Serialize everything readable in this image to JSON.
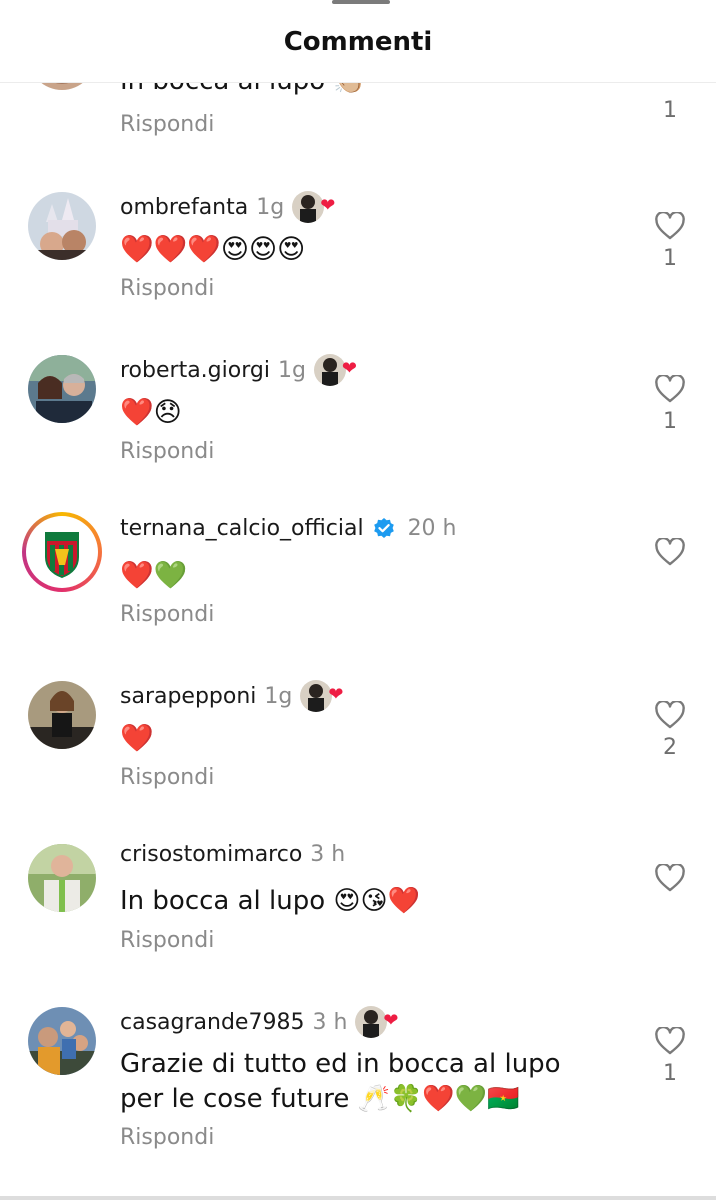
{
  "header": {
    "title": "Commenti"
  },
  "partial_comment": {
    "text": "In bocca al lupo 👏🏼",
    "reply": "Rispondi",
    "likes": "1"
  },
  "comments": [
    {
      "username": "ombrefanta",
      "time": "1g",
      "author_liked": true,
      "text": "❤️❤️❤️😍😍😍",
      "reply": "Rispondi",
      "likes": "1",
      "avatar": "disney-castle-selfie"
    },
    {
      "username": "roberta.giorgi",
      "time": "1g",
      "author_liked": true,
      "text": "❤️😞",
      "reply": "Rispondi",
      "likes": "1",
      "avatar": "couple-selfie"
    },
    {
      "username": "ternana_calcio_official",
      "time": "20 h",
      "verified": true,
      "author_liked": false,
      "text": "❤️💚",
      "reply": "Rispondi",
      "likes": "",
      "avatar": "ternana-crest"
    },
    {
      "username": "sarapepponi",
      "time": "1g",
      "author_liked": true,
      "text": "❤️",
      "reply": "Rispondi",
      "likes": "2",
      "avatar": "woman-portrait"
    },
    {
      "username": "crisostomimarco",
      "time": "3 h",
      "author_liked": false,
      "text": "In bocca al lupo 😍😘❤️",
      "reply": "Rispondi",
      "likes": "",
      "avatar": "man-suit"
    },
    {
      "username": "casagrande7985",
      "time": "3 h",
      "author_liked": true,
      "text_line1": "Grazie di tutto ed in bocca al lupo",
      "text_line2": "per le cose future 🥂🍀❤️💚🇧🇫",
      "reply": "Rispondi",
      "likes": "1",
      "avatar": "group-outdoor"
    }
  ],
  "colors": {
    "like_heart_red": "#ee1d43",
    "muted_text": "#8a8a8a",
    "verified_blue": "#1d9bf0"
  },
  "icons": {
    "like": "heart-outline-icon",
    "verified": "verified-badge-icon",
    "author_like": "author-heart-icon"
  }
}
